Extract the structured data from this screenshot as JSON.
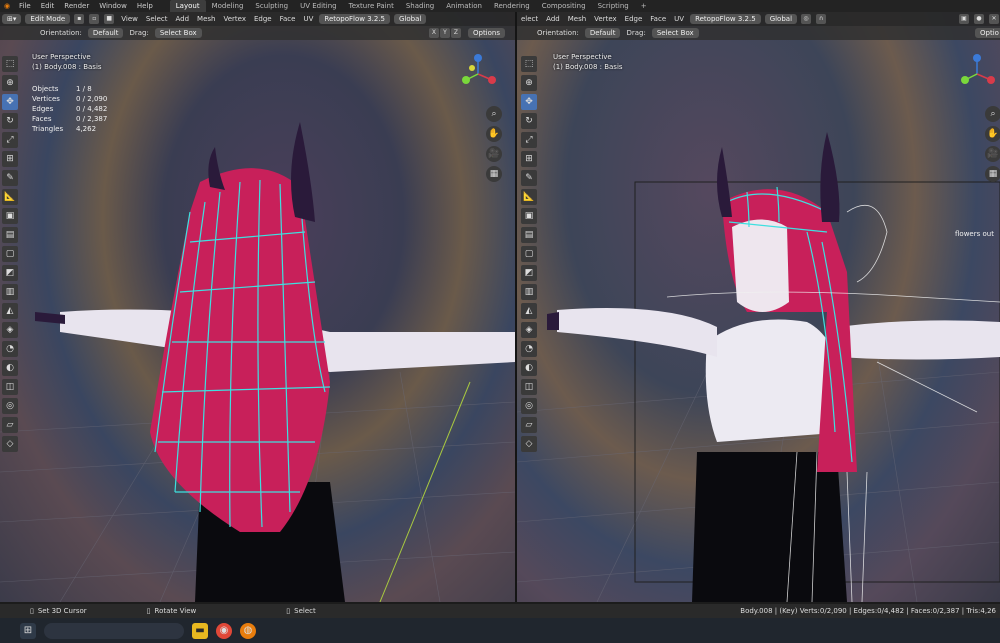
{
  "menu": {
    "items": [
      "File",
      "Edit",
      "Render",
      "Window",
      "Help"
    ]
  },
  "workspaces": {
    "tabs": [
      "Layout",
      "Modeling",
      "Sculpting",
      "UV Editing",
      "Texture Paint",
      "Shading",
      "Animation",
      "Rendering",
      "Compositing",
      "Scripting"
    ],
    "active": "Layout",
    "add_label": "+"
  },
  "left_viewport": {
    "mode": "Edit Mode",
    "menus": [
      "View",
      "Select",
      "Add",
      "Mesh",
      "Vertex",
      "Edge",
      "Face",
      "UV"
    ],
    "addon": "RetopoFlow 3.2.5",
    "transform": "Global",
    "orientation_label": "Orientation:",
    "orientation_value": "Default",
    "drag_label": "Drag:",
    "drag_value": "Select Box",
    "axes": [
      "X",
      "Y",
      "Z"
    ],
    "options": "Options",
    "view_name": "User Perspective",
    "object_name": "(1) Body.008 : Basis",
    "stats": [
      {
        "k": "Objects",
        "v": "1 / 8"
      },
      {
        "k": "Vertices",
        "v": "0 / 2,090"
      },
      {
        "k": "Edges",
        "v": "0 / 4,482"
      },
      {
        "k": "Faces",
        "v": "0 / 2,387"
      },
      {
        "k": "Triangles",
        "v": "4,262"
      }
    ]
  },
  "right_viewport": {
    "menus": [
      "elect",
      "Add",
      "Mesh",
      "Vertex",
      "Edge",
      "Face",
      "UV"
    ],
    "addon": "RetopoFlow 3.2.5",
    "transform": "Global",
    "orientation_label": "Orientation:",
    "orientation_value": "Default",
    "drag_label": "Drag:",
    "drag_value": "Select Box",
    "options": "Options",
    "options_cut": "Optio",
    "view_name": "User Perspective",
    "object_name": "(1) Body.008 : Basis",
    "side_text": "flowers out"
  },
  "status": {
    "left_hint": "Set 3D Cursor",
    "mid_hint": "Rotate View",
    "right_hint": "Select",
    "scene_stats": "Body.008 | (Key) Verts:0/2,090 | Edges:0/4,482 | Faces:0/2,387 | Tris:4,26"
  },
  "colors": {
    "accent": "#4772b3",
    "wire": "#3ee0e0",
    "hair": "#c8205a",
    "horn": "#2a1a3a"
  }
}
